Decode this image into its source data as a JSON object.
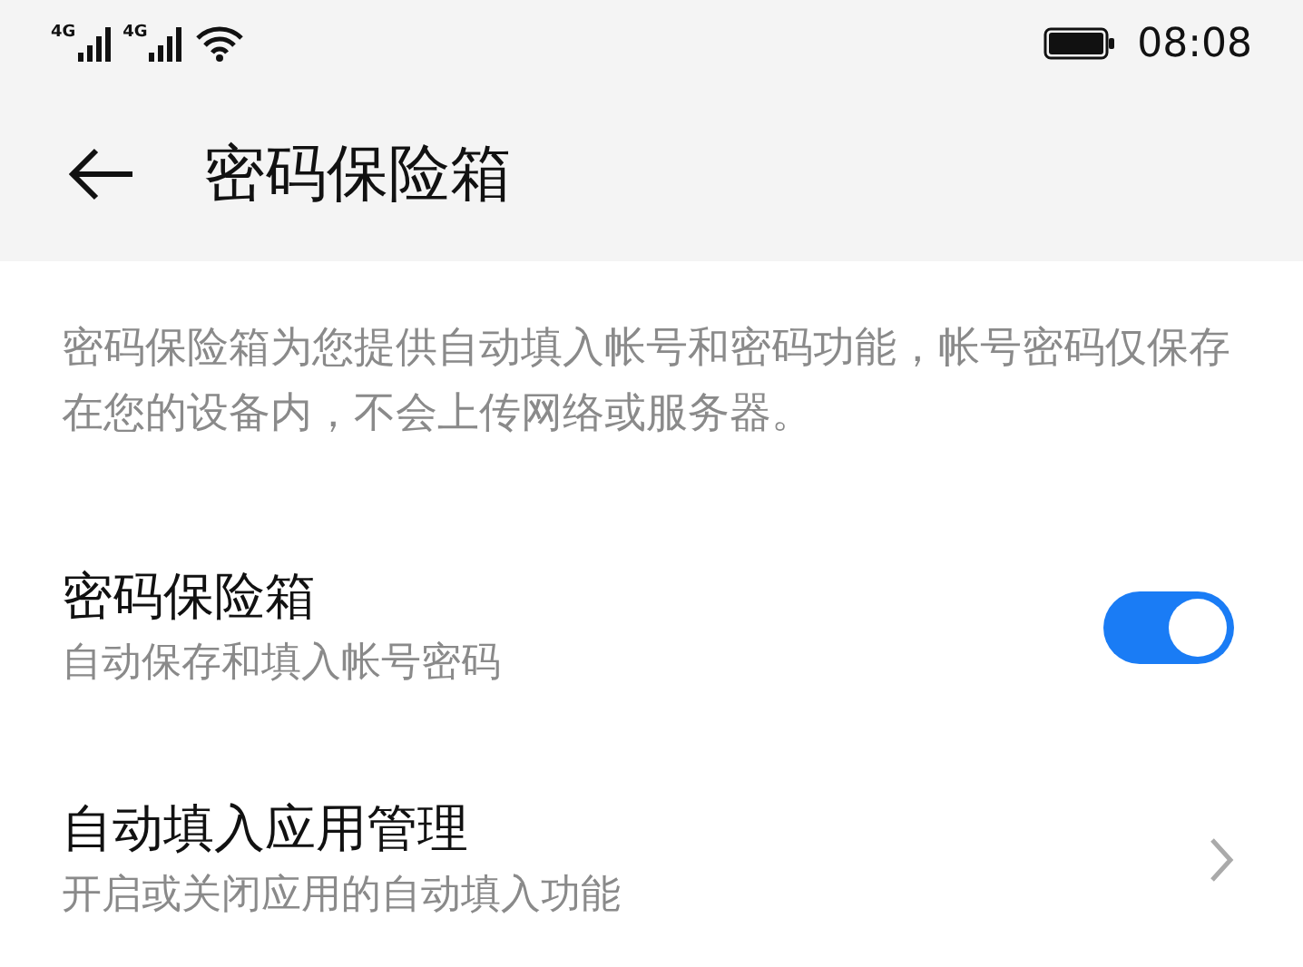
{
  "status_bar": {
    "signals": [
      {
        "label": "4G"
      },
      {
        "label": "4G"
      }
    ],
    "time": "08:08"
  },
  "header": {
    "title": "密码保险箱"
  },
  "description": "密码保险箱为您提供自动填入帐号和密码功能，帐号密码仅保存在您的设备内，不会上传网络或服务器。",
  "settings": [
    {
      "kind": "switch",
      "title": "密码保险箱",
      "subtitle": "自动保存和填入帐号密码",
      "on": true
    },
    {
      "kind": "link",
      "title": "自动填入应用管理",
      "subtitle": "开启或关闭应用的自动填入功能"
    }
  ]
}
